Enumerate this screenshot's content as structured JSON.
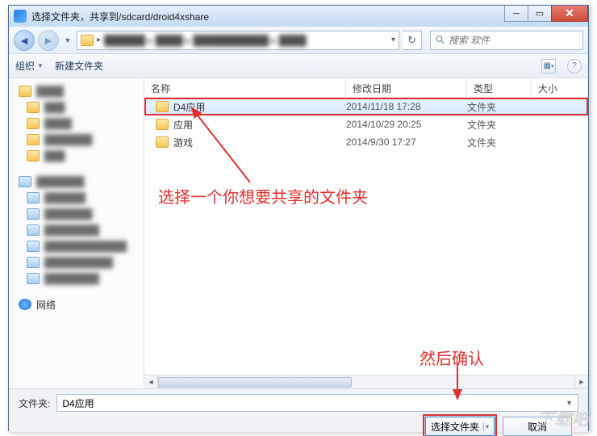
{
  "titlebar": {
    "title": "选择文件夹，共享到/sdcard/droid4xshare"
  },
  "search": {
    "placeholder": "搜索 软件"
  },
  "toolbar": {
    "organize": "组织",
    "newfolder": "新建文件夹"
  },
  "columns": {
    "name": "名称",
    "date": "修改日期",
    "type": "类型",
    "size": "大小"
  },
  "sidebar_network": "网络",
  "rows": [
    {
      "name": "D4应用",
      "date": "2014/11/18 17:28",
      "type": "文件夹",
      "selected": true,
      "highlight": true
    },
    {
      "name": "应用",
      "date": "2014/10/29 20:25",
      "type": "文件夹",
      "selected": false,
      "highlight": false
    },
    {
      "name": "游戏",
      "date": "2014/9/30 17:27",
      "type": "文件夹",
      "selected": false,
      "highlight": false
    }
  ],
  "folder_label": "文件夹:",
  "folder_value": "D4应用",
  "buttons": {
    "select": "选择文件夹",
    "cancel": "取消"
  },
  "annotations": {
    "a1": "选择一个你想要共享的文件夹",
    "a2": "然后确认"
  },
  "watermark": "下载吧"
}
